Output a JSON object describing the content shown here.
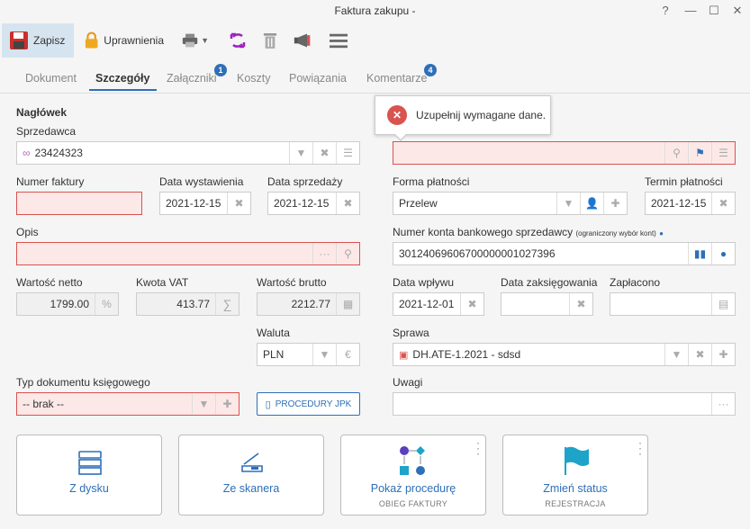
{
  "window": {
    "title": "Faktura zakupu -",
    "help": "?",
    "minimize": "—",
    "maximize": "☐",
    "close": "✕"
  },
  "toolbar": {
    "save": "Zapisz",
    "permissions": "Uprawnienia"
  },
  "tabs": [
    {
      "label": "Dokument"
    },
    {
      "label": "Szczegóły"
    },
    {
      "label": "Załączniki",
      "badge": "1"
    },
    {
      "label": "Koszty"
    },
    {
      "label": "Powiązania"
    },
    {
      "label": "Komentarze",
      "badge": "4"
    }
  ],
  "tooltip": {
    "text": "Uzupełnij wymagane dane."
  },
  "form": {
    "header_section": "Nagłówek",
    "seller_label": "Sprzedawca",
    "seller_value": "23424323",
    "invoice_no_label": "Numer faktury",
    "invoice_no_value": "",
    "issue_date_label": "Data wystawienia",
    "issue_date_value": "2021-12-15",
    "sale_date_label": "Data sprzedaży",
    "sale_date_value": "2021-12-15",
    "payment_form_label": "Forma płatności",
    "payment_form_value": "Przelew",
    "payment_due_label": "Termin płatności",
    "payment_due_value": "2021-12-15",
    "description_label": "Opis",
    "description_value": "",
    "account_label": "Numer konta bankowego sprzedawcy",
    "account_note": "(ograniczony wybór kont)",
    "account_value": "30124069606700000001027396",
    "net_label": "Wartość netto",
    "net_value": "1799.00",
    "net_unit": "%",
    "vat_label": "Kwota VAT",
    "vat_value": "413.77",
    "vat_sym": "∑",
    "gross_label": "Wartość brutto",
    "gross_value": "2212.77",
    "receipt_date_label": "Data wpływu",
    "receipt_date_value": "2021-12-01",
    "posting_date_label": "Data zaksięgowania",
    "posting_date_value": "",
    "paid_label": "Zapłacono",
    "paid_value": "",
    "currency_label": "Waluta",
    "currency_value": "PLN",
    "currency_sym": "€",
    "case_label": "Sprawa",
    "case_value": "DH.ATE-1.2021 - sdsd",
    "doc_type_label": "Typ dokumentu księgowego",
    "doc_type_value": "-- brak --",
    "jpk_button": "PROCEDURY JPK",
    "notes_label": "Uwagi",
    "notes_value": ""
  },
  "cards": [
    {
      "label": "Z dysku",
      "sub": ""
    },
    {
      "label": "Ze skanera",
      "sub": ""
    },
    {
      "label": "Pokaż procedurę",
      "sub": "OBIEG FAKTURY"
    },
    {
      "label": "Zmień status",
      "sub": "REJESTRACJA"
    }
  ],
  "colors": {
    "accent": "#2e6fb7",
    "error": "#d9534f",
    "error_bg": "#fde8e8"
  }
}
